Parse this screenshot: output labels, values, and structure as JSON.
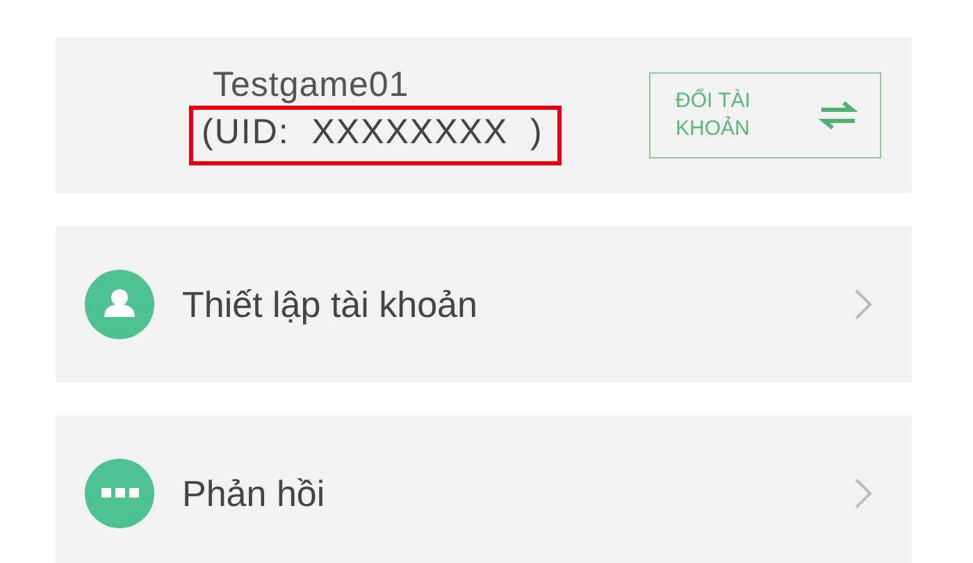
{
  "account": {
    "name": "Testgame01",
    "uid": "(UID:  XXXXXXXX  )",
    "uid_highlighted": true,
    "switch_button": "ĐỔI TÀI KHOẢN"
  },
  "menu": [
    {
      "kind": "profile",
      "label": "Thiết lập tài khoản"
    },
    {
      "kind": "feedback",
      "label": "Phản hồi"
    }
  ]
}
